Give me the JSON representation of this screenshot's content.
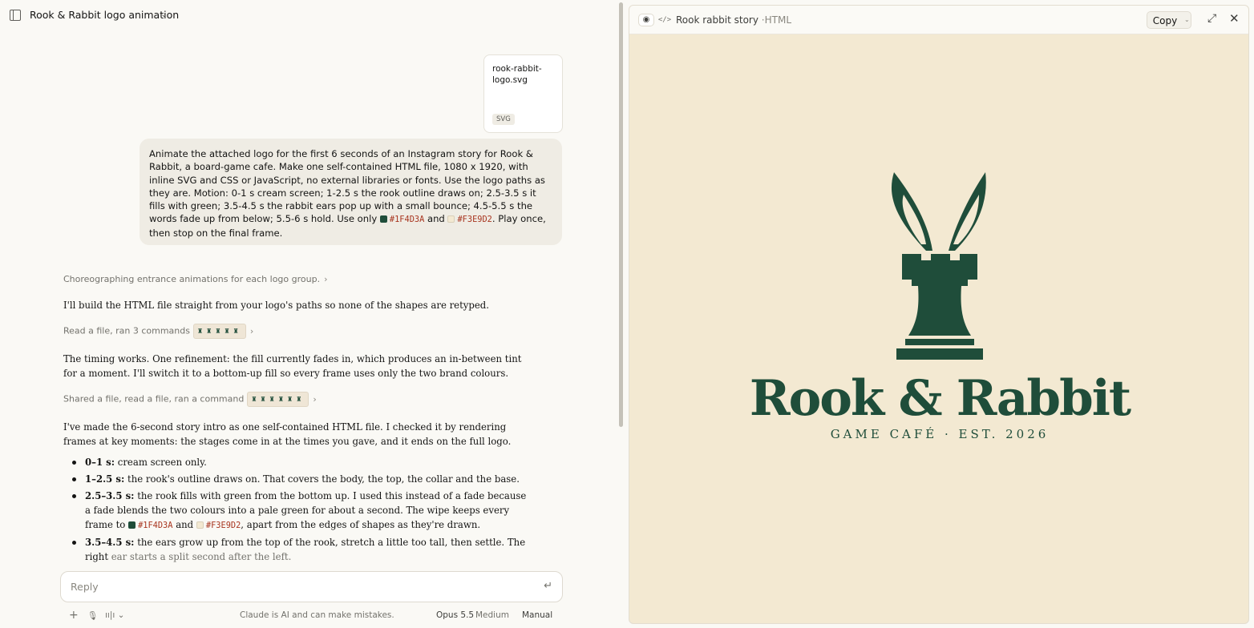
{
  "chat": {
    "title": "Rook & Rabbit logo animation",
    "attachment": {
      "name": "rook-rabbit-logo.svg",
      "type": "SVG"
    },
    "user_message": {
      "text_before": "Animate the attached logo for the first 6 seconds of an Instagram story for Rook & Rabbit, a board-game cafe. Make one self-contained HTML file, 1080 x 1920, with inline SVG and CSS or JavaScript, no external libraries or fonts. Use the logo paths as they are. Motion: 0-1 s cream screen; 1-2.5 s the rook outline draws on; 2.5-3.5 s it fills with green; 3.5-4.5 s the rabbit ears pop up with a small bounce; 4.5-5.5 s the words fade up from below; 5.5-6 s hold. Use only",
      "color1": "#1F4D3A",
      "and": "and",
      "color2": "#F3E9D2",
      "text_after": ". Play once, then stop on the final frame."
    },
    "thinking": "Choreographing entrance animations for each logo group.",
    "para1": "I'll build the HTML file straight from your logo's paths so none of the shapes are retyped.",
    "action1": "Read a file, ran 3 commands",
    "para2": "The timing works. One refinement: the fill currently fades in, which produces an in-between tint for a moment. I'll switch it to a bottom-up fill so every frame uses only the two brand colours.",
    "action2": "Shared a file, read a file, ran a command",
    "para3": "I've made the 6-second story intro as one self-contained HTML file. I checked it by rendering frames at key moments: the stages come in at the times you gave, and it ends on the full logo.",
    "bullets": [
      {
        "label": "0–1 s:",
        "text": "cream screen only."
      },
      {
        "label": "1–2.5 s:",
        "text": "the rook's outline draws on. That covers the body, the top, the collar and the base."
      },
      {
        "label": "2.5–3.5 s:",
        "text_before": "the rook fills with green from the bottom up. I used this instead of a fade because a fade blends the two colours into a pale green for about a second. The wipe keeps every frame to",
        "color1": "#1F4D3A",
        "and": "and",
        "color2": "#F3E9D2",
        "text_after": ", apart from the edges of shapes as they're drawn."
      },
      {
        "label": "3.5–4.5 s:",
        "text": "the ears grow up from the top of the rook, stretch a little too tall, then settle. The right",
        "text_faded": "ear starts a split second after the left."
      }
    ],
    "reply_placeholder": "Reply",
    "footer": {
      "disclaimer": "Claude is AI and can make mistakes.",
      "model": "Opus 5.5",
      "effort": "Medium",
      "mode": "Manual"
    }
  },
  "artifact": {
    "title": "Rook rabbit story",
    "separator": "·",
    "type": "HTML",
    "copy_label": "Copy",
    "wordmark": "Rook & Rabbit",
    "tagline": "GAME CAFÉ · EST. 2026",
    "colors": {
      "green": "#1F4D3A",
      "cream": "#F3E9D2"
    }
  },
  "icons": [
    "sidebar-toggle-icon",
    "chevron-down-icon",
    "eye-icon",
    "code-icon",
    "expand-icon",
    "close-icon",
    "plus-icon",
    "mic-icon",
    "voice-icon",
    "send-icon"
  ]
}
